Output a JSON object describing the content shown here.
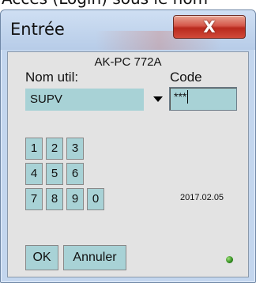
{
  "window": {
    "title": "Entrée",
    "close_glyph": "X",
    "header_text_clipped": "Accès (Login) sous le nom"
  },
  "login": {
    "device_name": "AK-PC 772A",
    "user_label": "Nom util:",
    "user_value": "SUPV",
    "code_label": "Code",
    "code_value": "***",
    "date": "2017.02.05"
  },
  "keypad": {
    "keys": [
      "1",
      "2",
      "3",
      "4",
      "5",
      "6",
      "7",
      "8",
      "9",
      "0"
    ]
  },
  "buttons": {
    "ok": "OK",
    "cancel": "Annuler"
  },
  "colors": {
    "field_bg": "#a8d2d6",
    "dialog_bg": "#e3e3e3",
    "frame": "#c3d6ee",
    "close_red": "#c8382b",
    "status_green": "#2f8a1e"
  }
}
